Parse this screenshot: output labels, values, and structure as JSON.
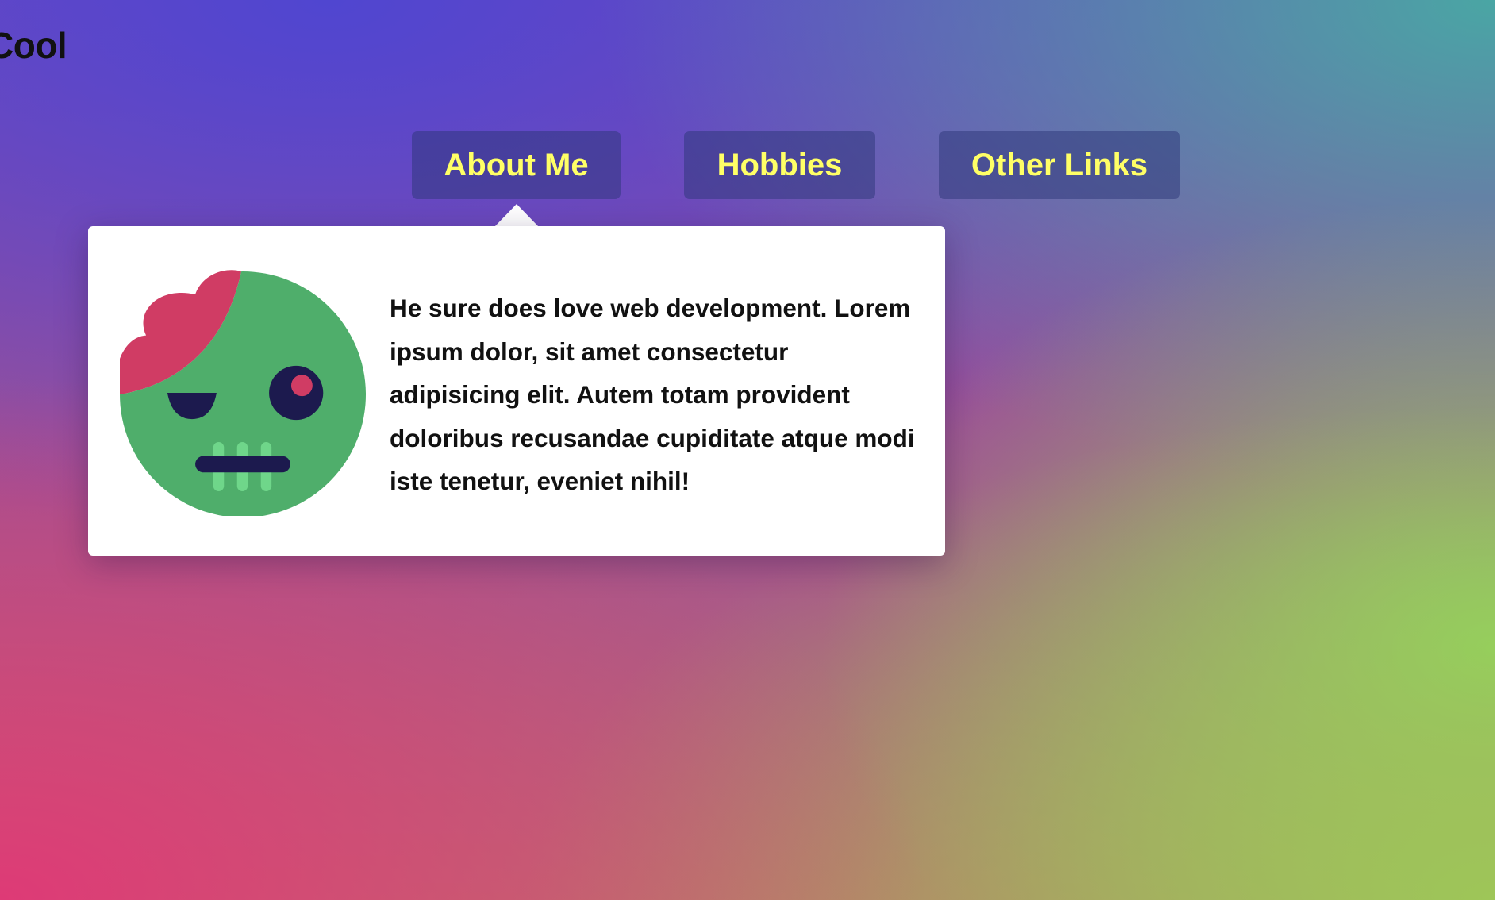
{
  "brand": {
    "text": "Cool"
  },
  "nav": {
    "items": [
      {
        "label": "About Me"
      },
      {
        "label": "Hobbies"
      },
      {
        "label": "Other Links"
      }
    ]
  },
  "popover": {
    "avatar_icon": "zombie-face-icon",
    "text": "He sure does love web development. Lorem ipsum dolor, sit amet consectetur adipisicing elit. Autem totam provident doloribus recusandae cupiditate atque modi iste tenetur, eveniet nihil!"
  },
  "colors": {
    "nav_text": "#ffff66",
    "nav_bg": "#2c3678",
    "popover_bg": "#ffffff",
    "zombie_skin": "#4fae6b",
    "zombie_brain": "#d03c64",
    "zombie_dark": "#1c1a4e",
    "zombie_teeth": "#6fd68a"
  }
}
